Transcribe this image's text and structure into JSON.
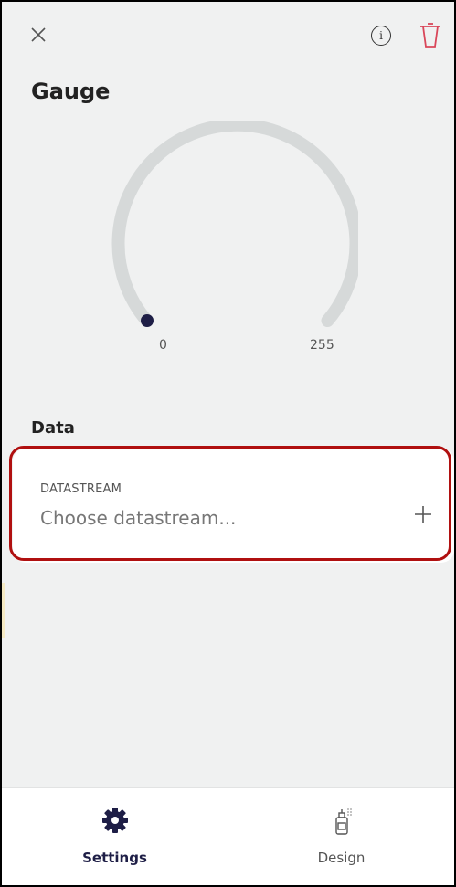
{
  "header": {
    "close_icon": "close-icon",
    "info_icon": "info-icon",
    "info_glyph": "i",
    "delete_icon": "trash-icon",
    "delete_color": "#d9475a"
  },
  "widget": {
    "title": "Gauge"
  },
  "gauge": {
    "min_label": "0",
    "max_label": "255",
    "track_color": "#d6d9d9",
    "indicator_color": "#1e1e46",
    "value_fraction": 0
  },
  "data_section": {
    "title": "Data",
    "datastream_label": "DATASTREAM",
    "datastream_placeholder": "Choose datastream...",
    "add_icon": "plus-icon",
    "highlight_color": "#b01010"
  },
  "tabs": [
    {
      "label": "Settings",
      "icon": "gear-icon",
      "active": true
    },
    {
      "label": "Design",
      "icon": "spray-paint-icon",
      "active": false
    }
  ],
  "colors": {
    "background": "#f0f1f1",
    "active_tab": "#1e1e46"
  }
}
